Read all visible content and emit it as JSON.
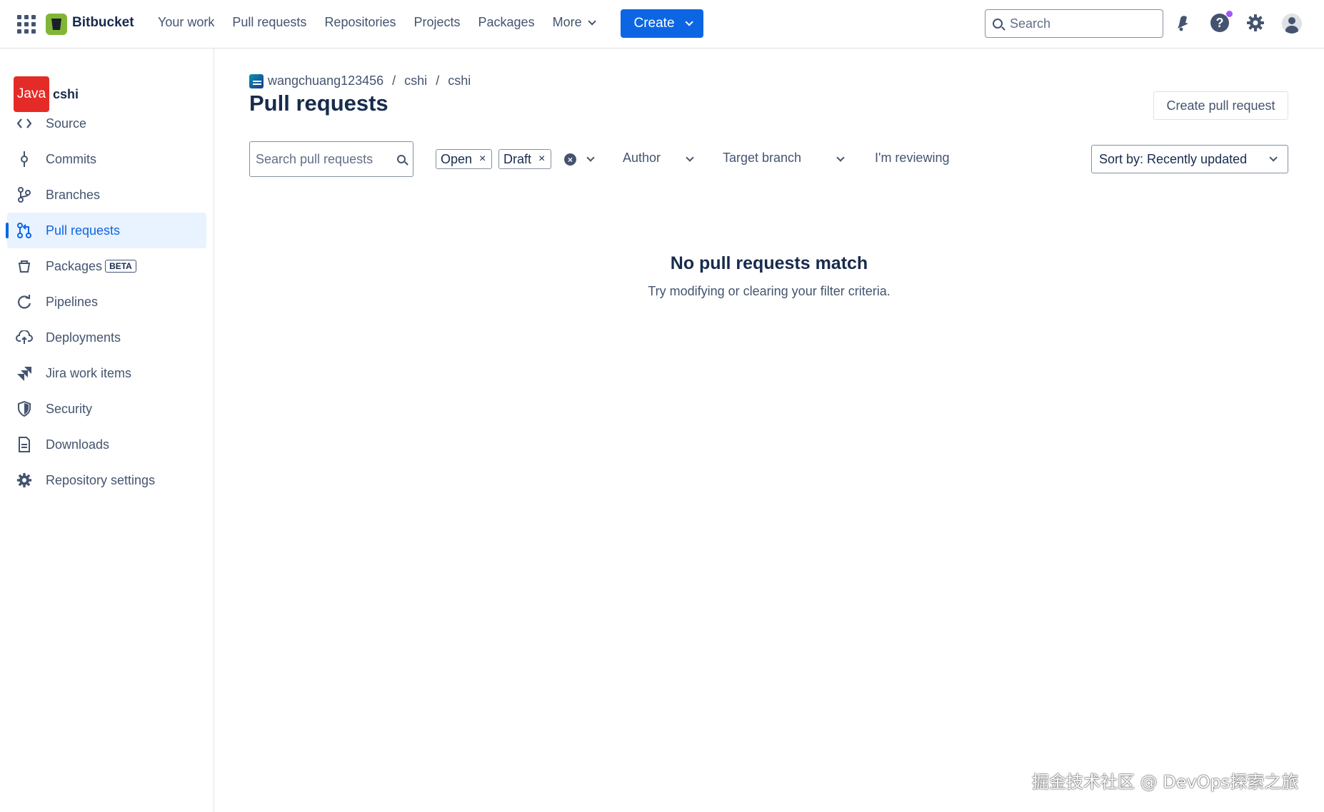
{
  "topbar": {
    "brand": "Bitbucket",
    "nav": [
      "Your work",
      "Pull requests",
      "Repositories",
      "Projects",
      "Packages",
      "More"
    ],
    "create_label": "Create",
    "search_placeholder": "Search",
    "notification_dot_color": "#a855f7",
    "accent_color": "#0c66e4"
  },
  "sidebar": {
    "repo_avatar_text": "Java",
    "repo_name": "cshi",
    "items": [
      {
        "label": "Source",
        "icon": "code-icon"
      },
      {
        "label": "Commits",
        "icon": "commit-icon"
      },
      {
        "label": "Branches",
        "icon": "branch-icon"
      },
      {
        "label": "Pull requests",
        "icon": "pull-request-icon",
        "active": true
      },
      {
        "label": "Packages",
        "icon": "package-icon",
        "badge": "BETA"
      },
      {
        "label": "Pipelines",
        "icon": "pipelines-icon"
      },
      {
        "label": "Deployments",
        "icon": "cloud-upload-icon"
      },
      {
        "label": "Jira work items",
        "icon": "jira-icon"
      },
      {
        "label": "Security",
        "icon": "shield-icon"
      },
      {
        "label": "Downloads",
        "icon": "file-icon"
      },
      {
        "label": "Repository settings",
        "icon": "gear-icon"
      }
    ]
  },
  "main": {
    "breadcrumb": [
      "wangchuang123456",
      "cshi",
      "cshi"
    ],
    "title": "Pull requests",
    "create_pr_label": "Create pull request",
    "filters": {
      "search_placeholder": "Search pull requests",
      "chips": [
        "Open",
        "Draft"
      ],
      "author_label": "Author",
      "target_branch_label": "Target branch",
      "reviewing_label": "I'm reviewing",
      "sort_label": "Sort by: Recently updated"
    },
    "empty": {
      "title": "No pull requests match",
      "subtitle": "Try modifying or clearing your filter criteria."
    }
  },
  "watermark": "掘金技术社区 @ DevOps探索之旅"
}
